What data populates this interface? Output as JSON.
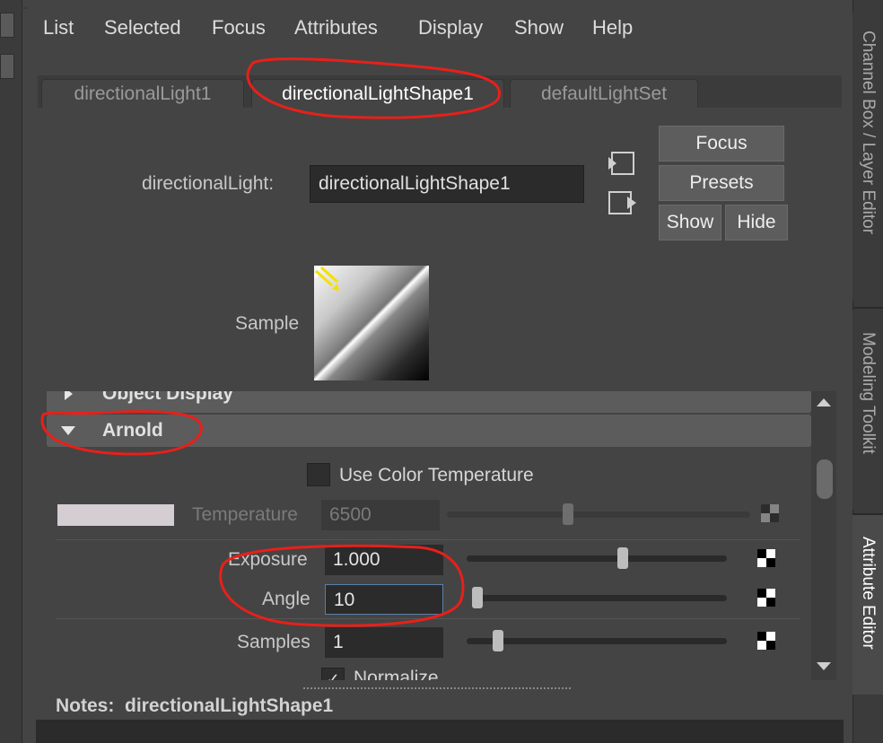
{
  "menu": {
    "items": [
      "List",
      "Selected",
      "Focus",
      "Attributes",
      "Display",
      "Show",
      "Help"
    ]
  },
  "tabs": [
    {
      "label": "directionalLight1",
      "active": false
    },
    {
      "label": "directionalLightShape1",
      "active": true
    },
    {
      "label": "defaultLightSet",
      "active": false
    }
  ],
  "header": {
    "node_type_label": "directionalLight:",
    "node_name_value": "directionalLightShape1",
    "focus_label": "Focus",
    "presets_label": "Presets",
    "show_label": "Show",
    "hide_label": "Hide",
    "sample_label": "Sample"
  },
  "sections": {
    "object_display": "Object Display",
    "arnold": "Arnold"
  },
  "arnold": {
    "use_color_temperature_label": "Use Color Temperature",
    "use_color_temperature_checked": false,
    "temperature_label": "Temperature",
    "temperature_value": "6500",
    "temperature_slider": 0.4,
    "exposure_label": "Exposure",
    "exposure_value": "1.000",
    "exposure_slider": 0.6,
    "angle_label": "Angle",
    "angle_value": "10",
    "angle_slider": 0.0,
    "samples_label": "Samples",
    "samples_value": "1",
    "samples_slider": 0.12,
    "normalize_label": "Normalize"
  },
  "notes": {
    "label": "Notes:",
    "value": "directionalLightShape1"
  },
  "right_tabs": [
    "Channel Box / Layer Editor",
    "Modeling Toolkit",
    "Attribute Editor"
  ],
  "colors": {
    "annotation": "#e8201a",
    "background": "#444444",
    "field": "#2b2b2b",
    "section_bar": "#5c5c5c"
  }
}
